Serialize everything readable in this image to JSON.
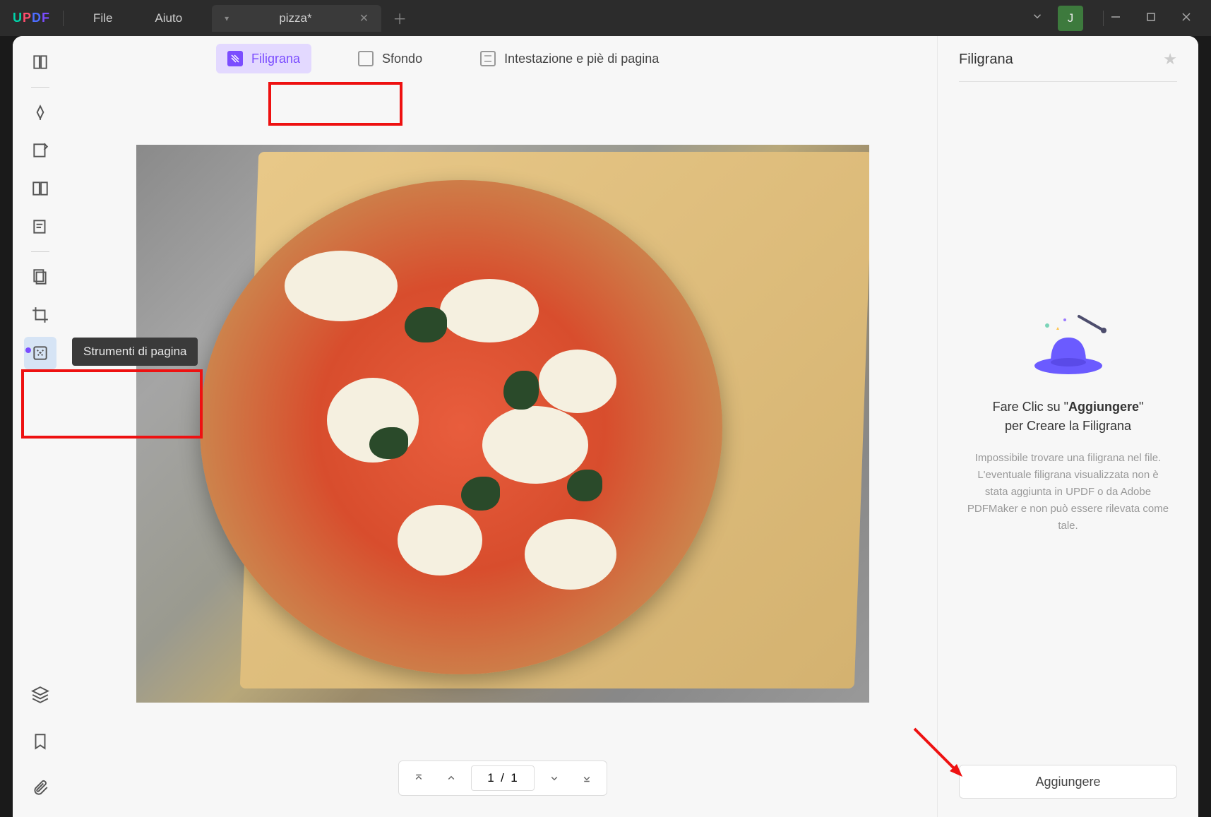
{
  "titlebar": {
    "menu_file": "File",
    "menu_help": "Aiuto",
    "tab_title": "pizza*",
    "avatar_letter": "J"
  },
  "tooltip": {
    "page_tools": "Strumenti di pagina"
  },
  "toolbar": {
    "watermark": "Filigrana",
    "background": "Sfondo",
    "header_footer": "Intestazione e piè di pagina"
  },
  "page_controls": {
    "page_display": "1  /  1",
    "current": 1,
    "total": 1
  },
  "panel": {
    "title": "Filigrana",
    "msg_prefix": "Fare Clic su \"",
    "msg_bold": "Aggiungere",
    "msg_suffix": "\"",
    "msg_line2": "per Creare la Filigrana",
    "desc": "Impossibile trovare una filigrana nel file. L'eventuale filigrana visualizzata non è stata aggiunta in UPDF o da Adobe PDFMaker e non può essere rilevata come tale.",
    "add_button": "Aggiungere"
  }
}
